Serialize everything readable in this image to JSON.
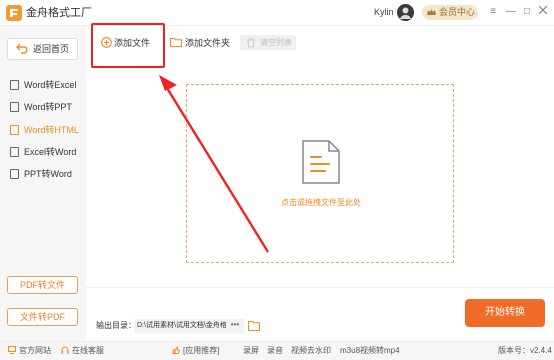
{
  "app": {
    "title": "金舟格式工厂"
  },
  "header": {
    "user_name": "Kylin",
    "vip_label": "会员中心"
  },
  "window_controls": {
    "menu": "≡",
    "minimize": "—",
    "maximize": "□"
  },
  "sidebar": {
    "back_label": "返回首页",
    "items": [
      {
        "label": "Word转Excel"
      },
      {
        "label": "Word转PPT"
      },
      {
        "label": "Word转HTML"
      },
      {
        "label": "Excel转Word"
      },
      {
        "label": "PPT转Word"
      }
    ],
    "active_index": 2,
    "bottom_buttons": [
      "PDF转文件",
      "文件转PDF"
    ]
  },
  "toolbar": {
    "add_file": "添加文件",
    "add_folder": "添加文件夹",
    "clear_list": "清空列表"
  },
  "dropzone": {
    "hint": "点击或拖拽文件至此处"
  },
  "output": {
    "label": "输出目录：",
    "path": "D:\\试用素材\\试用文档\\金舟格",
    "more": "•••"
  },
  "actions": {
    "start": "开始转换"
  },
  "status": {
    "website": "官方网站",
    "support": "在线客服",
    "recommend": "[应用推荐]",
    "links": [
      "录屏",
      "录音",
      "视频去水印",
      "m3u8视频转mp4"
    ],
    "version": "版本号：v2.4.4"
  },
  "colors": {
    "accent": "#f08c24",
    "start_button": "#f06a28",
    "annotation": "#e22222"
  }
}
